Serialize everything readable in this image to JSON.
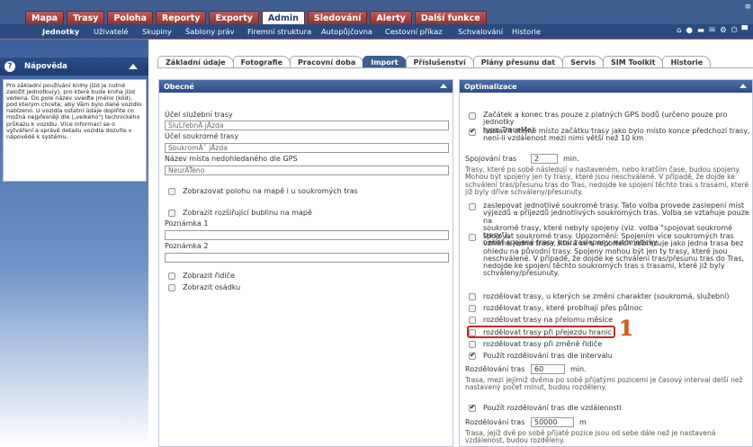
{
  "top_tabs": [
    "Mapa",
    "Trasy",
    "Poloha",
    "Reporty",
    "Exporty",
    "Admin",
    "Sledování",
    "Alerty",
    "Další funkce"
  ],
  "top_tab_active": "Admin",
  "sub_nav": [
    "Jednotky",
    "Uživatelé",
    "Skupiny",
    "Šablony práv",
    "Firemní struktura",
    "Autopůjčovna",
    "Cestovní příkaz",
    "Schvalování",
    "Historie"
  ],
  "sub_nav_active": "Jednotky",
  "help": {
    "title": "Nápověda",
    "text": "Pro základní používání knihy jízd je nutné založit jednotku(y), pro které bude kniha jízd vedena. Do pole název uveďte jméno (kód), pod kterým chcete, aby Vám bylo dané vozidlo nabízeno. U vozidla ostatní údaje doplňte co možná nejpřesněji dle („velkého\") technického průkazu k vozidlu. Více informací se o vytváření a správě detailu vozidla dozvíte v nápovědě k systému."
  },
  "content_tabs": [
    "Základní údaje",
    "Fotografie",
    "Pracovní doba",
    "Import",
    "Příslušenství",
    "Plány přesunu dat",
    "Servis",
    "SIM Toolkit",
    "Historie"
  ],
  "content_tab_active": "Import",
  "left_panel": {
    "title": "Obecné",
    "business_trip_label": "Účel služební trasy",
    "business_trip_value": "SluĹľebnĂ jĂzda",
    "private_trip_label": "Účel soukromé trasy",
    "private_trip_value": "SoukromĂˇ jĂzda",
    "unknown_place_label": "Název místa nedohledaného dle GPS",
    "unknown_place_value": "NeurÄŤeno",
    "cb_show_position": "Zobrazovat polohu na mapě i u soukromých tras",
    "cb_show_bubble": "Zobrazit rozšiřující bublinu na mapě",
    "note1_label": "Poznámka 1",
    "note2_label": "Poznámka 2",
    "cb_show_driver": "Zobrazit řidiče",
    "cb_show_crew": "Zobrazit osádku"
  },
  "right_panel": {
    "title": "Optimalizace",
    "opt1_line1": "Začátek a konec tras pouze z platných GPS bodů (určeno pouze pro jednotky",
    "opt1_line2": "typu TraceMe)",
    "opt2_line1": "nastavit stejné místo začátku trasy jako bylo místo konce předchozí trasy,",
    "opt2_line2": "není-li vzdálenost mezi nimi větší než 10 km",
    "joining_label": "Spojování tras",
    "joining_value": "2",
    "joining_unit": "min.",
    "joining_note": [
      "Trasy, které po sobě následují v nastaveném, nebo kratším čase, budou spojeny.",
      "Mohou být spojeny jen ty trasy, které jsou neschválené. V případě, že dojde ke",
      "schválení tras/přesunu tras do Tras, nedojde ke spojení těchto tras s trasami, které",
      "již byly dříve schváleny/přesunuty."
    ],
    "cb_block_private": [
      "zaslepovat jednotlivé soukromé trasy. Tato volba provede zaslepení míst",
      "výjezdů a příjezdů jednotlivých soukromých tras. Volba se vztahuje pouze na",
      "soukromé trasy, které nebyly spojeny (viz. volba \"spojovat soukromé trasy\"),",
      "neboť spojené trasy jsou zaslepeny automaticky."
    ],
    "cb_join_private": [
      "spojovat soukromé trasy. Upozornění: Spojením více soukromých tras",
      "vznikne jedna trasa, která se v reportech zobrazuje jako jedna trasa bez",
      "ohledu na původní trasy. Spojeny mohou být jen ty trasy, které jsou",
      "neschválené. V případě, že dojde ke schválení tras/přesunu tras do Tras,",
      "nedojde ke spojení těchto soukromých tras s trasami, které již byly",
      "schváleny/přesunuty."
    ],
    "cb_split_character": "rozdělovat trasy, u kterých se změní charakter (soukromá, služební)",
    "cb_split_midnight": "rozdělovat trasy, které probíhají přes půlnoc",
    "cb_split_month": "rozdělovat trasy na přelomu měsíce",
    "cb_split_border": "rozdělovat trasy při přejezdu hranic",
    "cb_split_driver": "rozdělovat trasy při změně řidiče",
    "cb_split_interval": "Použít rozdělování tras dle intervalu",
    "split_interval_label": "Rozdělování tras",
    "split_interval_value": "60",
    "split_interval_unit": "min.",
    "split_interval_note": [
      "Trasa, mezi jejímiž dvěma po sobě přijatými pozicemi je časový interval delší než",
      "nastavený počet minut, budou rozděleny."
    ],
    "cb_split_distance": "Použít rozdělování tras dle vzdálenosti",
    "split_distance_label": "Rozdělování tras",
    "split_distance_value": "50000",
    "split_distance_unit": "m",
    "split_distance_note": [
      "Trasa, jejíž dvě po sobě přijaté pozice jsou od sebe dále než je nastavená",
      "vzdálenost, budou rozděleny."
    ]
  },
  "annotation_number": "1",
  "colors": {
    "nav_blue": "#3f5e92",
    "tab_red": "#a84646",
    "highlight": "#c62828",
    "marker": "#d65a1a"
  }
}
